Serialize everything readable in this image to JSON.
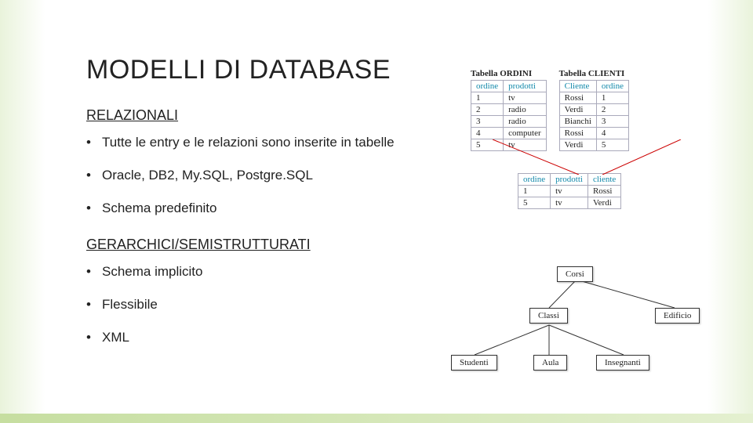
{
  "title": "MODELLI DI DATABASE",
  "section1": {
    "label": "RELAZIONALI",
    "bullets": [
      "Tutte le entry e le relazioni sono inserite in tabelle",
      "Oracle, DB2, My.SQL, Postgre.SQL",
      "Schema predefinito"
    ]
  },
  "section2": {
    "label": "GERARCHICI/SEMISTRUTTURATI",
    "bullets": [
      "Schema implicito",
      "Flessibile",
      "XML"
    ]
  },
  "figure1": {
    "left_title": "Tabella ORDINI",
    "right_title": "Tabella CLIENTI",
    "ordini_headers": [
      "ordine",
      "prodotti"
    ],
    "ordini_rows": [
      [
        "1",
        "tv"
      ],
      [
        "2",
        "radio"
      ],
      [
        "3",
        "radio"
      ],
      [
        "4",
        "computer"
      ],
      [
        "5",
        "tv"
      ]
    ],
    "clienti_headers": [
      "Cliente",
      "ordine"
    ],
    "clienti_rows": [
      [
        "Rossi",
        "1"
      ],
      [
        "Verdi",
        "2"
      ],
      [
        "Bianchi",
        "3"
      ],
      [
        "Rossi",
        "4"
      ],
      [
        "Verdi",
        "5"
      ]
    ],
    "join_headers": [
      "ordine",
      "prodotti",
      "cliente"
    ],
    "join_rows": [
      [
        "1",
        "tv",
        "Rossi"
      ],
      [
        "5",
        "tv",
        "Verdi"
      ]
    ]
  },
  "figure2": {
    "root": "Corsi",
    "mid": [
      "Classi",
      "Edificio"
    ],
    "leaf": [
      "Studenti",
      "Aula",
      "Insegnanti"
    ]
  }
}
